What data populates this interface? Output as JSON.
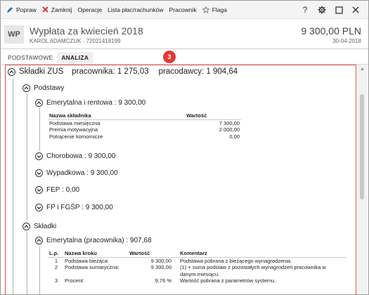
{
  "toolbar": {
    "popraw": "Popraw",
    "zamknij": "Zamknij",
    "operacje": "Operacje",
    "lista": "Lista płac/rachunków",
    "pracownik": "Pracownik",
    "flaga": "Flaga"
  },
  "header": {
    "avatar": "WP",
    "title": "Wypłata za kwiecień 2018",
    "subtitle": "KAROL ADAMCZUK · 72021418199",
    "amount": "9 300,00 PLN",
    "date": "30-04-2018"
  },
  "tabs": [
    "PODSTAWOWE",
    "ANALIZA"
  ],
  "badge": "3",
  "zus": {
    "title": "Składki ZUS",
    "pracownika": "pracownika: 1 275,03",
    "pracodawcy": "pracodawcy: 1 904,64"
  },
  "podstawy": {
    "label": "Podstawy",
    "emerytalna": "Emerytalna i rentowa :  9 300,00",
    "table_headers": [
      "Nazwa składnika",
      "Wartość"
    ],
    "table_rows": [
      [
        "Podstawa miesięczna",
        "7 300,00"
      ],
      [
        "Premia motywacyjna",
        "2 000,00"
      ],
      [
        "Potrącenie komornicze",
        "0,00"
      ]
    ],
    "chorobowa": "Chorobowa :  9 300,00",
    "wypadkowa": "Wypadkowa :  9 300,00",
    "fep": "FEP :  0,00",
    "fp": "FP i FGŚP :  9 300,00"
  },
  "skladki": {
    "label": "Składki",
    "emerytalna": "Emerytalna (pracownika) :  907,68",
    "table_headers": [
      "L.p.",
      "Nazwa kroku",
      "Wartość",
      "Komentarz"
    ],
    "table_rows": [
      [
        "1",
        "Podstawa bieżąca:",
        "9 300,00",
        "Podstawa pobrana z bieżącego wynagrodzenia."
      ],
      [
        "2",
        "Podstawa sumaryczna:",
        "9 300,00",
        "(1) + suma podstaw z pozostałych wynagrodzeń pracownika w"
      ],
      [
        "",
        "",
        "",
        "danym miesiącu."
      ],
      [
        "3",
        "Procent:",
        "9,76 %",
        "Wartość pobrana z parametrów systemu."
      ]
    ]
  },
  "colors": {
    "accent_red": "#e03a36",
    "toolbar_bg": "#f4f4f4"
  }
}
